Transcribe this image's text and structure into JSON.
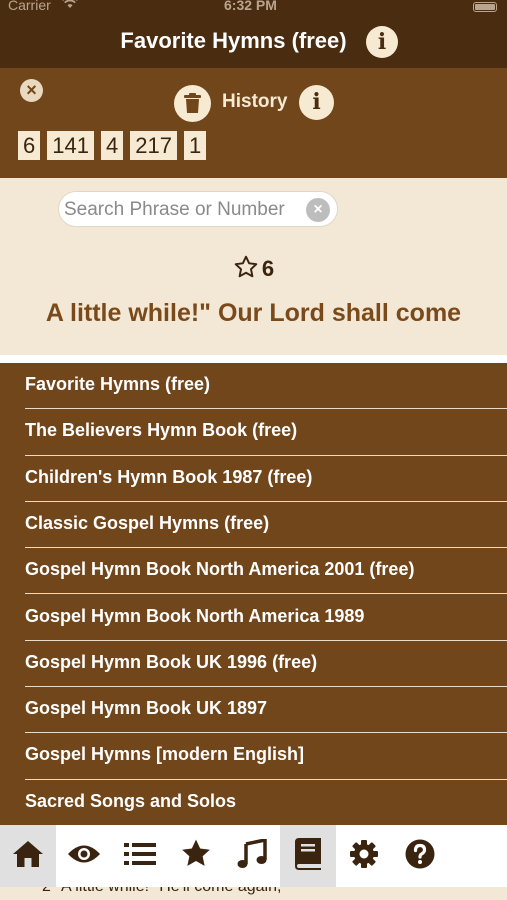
{
  "status_bar": {
    "carrier": "Carrier",
    "time": "6:32 PM"
  },
  "header": {
    "title": "Favorite Hymns (free)"
  },
  "history": {
    "label": "History",
    "chips": [
      "6",
      "141",
      "4",
      "217",
      "1"
    ]
  },
  "search": {
    "placeholder": "Search Phrase or Number",
    "value": ""
  },
  "current_hymn": {
    "number": "6",
    "title": "A little while!\" Our Lord shall come"
  },
  "books": [
    "Favorite Hymns (free)",
    "The Believers Hymn Book (free)",
    "Children's Hymn Book 1987 (free)",
    "Classic Gospel Hymns (free)",
    "Gospel Hymn Book North America 2001 (free)",
    "Gospel Hymn Book North America 1989",
    "Gospel Hymn Book UK 1996 (free)",
    "Gospel Hymn Book UK 1897",
    "Gospel Hymns [modern English]",
    "Sacred Songs and Solos"
  ],
  "tabs": [
    {
      "name": "home-icon",
      "active": true
    },
    {
      "name": "eye-icon",
      "active": false
    },
    {
      "name": "list-icon",
      "active": false
    },
    {
      "name": "star-icon",
      "active": false
    },
    {
      "name": "music-note-icon",
      "active": false
    },
    {
      "name": "book-icon",
      "active": true
    },
    {
      "name": "gear-icon",
      "active": false
    },
    {
      "name": "help-icon",
      "active": false
    }
  ],
  "peek_text": "2 \"A little while!\" He'll come again;",
  "colors": {
    "header_bg": "#4a2c10",
    "panel_bg": "#71461b",
    "parchment": "#f2e8d5",
    "accent_text": "#7a4a1a"
  }
}
